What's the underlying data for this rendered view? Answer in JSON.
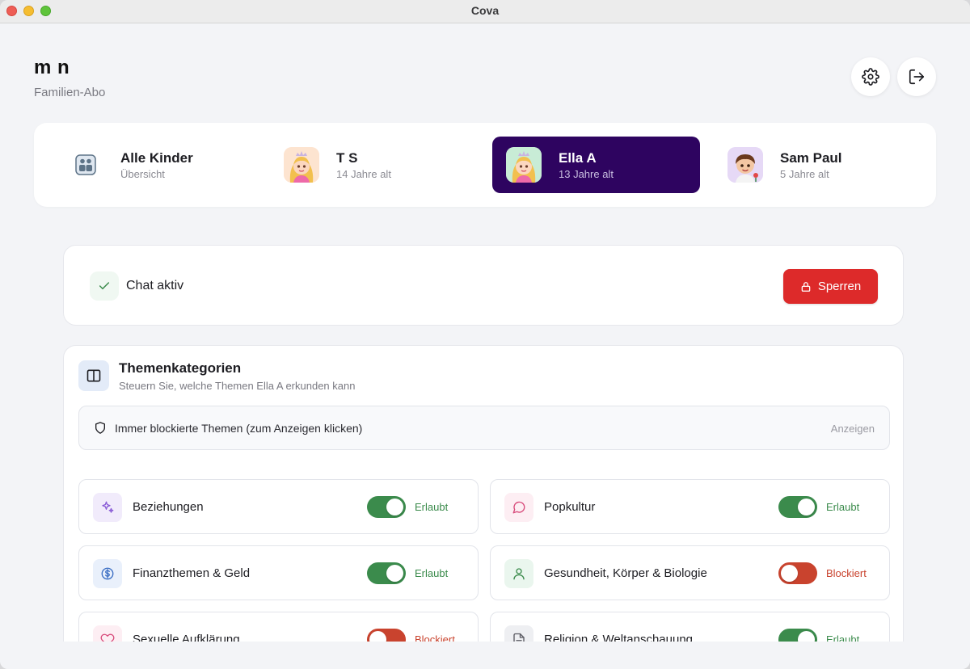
{
  "window": {
    "title": "Cova"
  },
  "header": {
    "user_name": "m n",
    "plan": "Familien-Abo"
  },
  "toolbar": {
    "settings_icon": "gear-icon",
    "logout_icon": "logout-icon"
  },
  "kids": [
    {
      "name": "Alle Kinder",
      "sub": "Übersicht",
      "active": false,
      "avatar": "family-icon"
    },
    {
      "name": "T S",
      "sub": "14 Jahre alt",
      "active": false,
      "avatar": "princess-avatar"
    },
    {
      "name": "Ella A",
      "sub": "13 Jahre alt",
      "active": true,
      "avatar": "princess-avatar"
    },
    {
      "name": "Sam Paul",
      "sub": "5 Jahre alt",
      "active": false,
      "avatar": "child-avatar"
    }
  ],
  "chat": {
    "status_label": "Chat aktiv",
    "lock_button": "Sperren"
  },
  "topics": {
    "title": "Themenkategorien",
    "subtitle": "Steuern Sie, welche Themen Ella A erkunden kann",
    "always_blocked": {
      "label": "Immer blockierte Themen (zum Anzeigen klicken)",
      "action": "Anzeigen"
    },
    "items": [
      {
        "label": "Beziehungen",
        "status": "Erlaubt",
        "allowed": true,
        "icon": "sparkles-icon",
        "icon_bg": "#f1ebfb",
        "icon_color": "#8a5cd6"
      },
      {
        "label": "Popkultur",
        "status": "Erlaubt",
        "allowed": true,
        "icon": "chat-bubble-icon",
        "icon_bg": "#fdeef3",
        "icon_color": "#d84b7b"
      },
      {
        "label": "Finanzthemen & Geld",
        "status": "Erlaubt",
        "allowed": true,
        "icon": "dollar-icon",
        "icon_bg": "#e9f0fb",
        "icon_color": "#3c6fc4"
      },
      {
        "label": "Gesundheit, Körper & Biologie",
        "status": "Blockiert",
        "allowed": false,
        "icon": "person-icon",
        "icon_bg": "#eaf6ee",
        "icon_color": "#3b8b4c"
      },
      {
        "label": "Sexuelle Aufklärung",
        "status": "Blockiert",
        "allowed": false,
        "icon": "heart-icon",
        "icon_bg": "#fdeef3",
        "icon_color": "#d84b7b"
      },
      {
        "label": "Religion & Weltanschauung",
        "status": "Erlaubt",
        "allowed": true,
        "icon": "document-icon",
        "icon_bg": "#eeeff2",
        "icon_color": "#5a5a62"
      }
    ]
  },
  "colors": {
    "active_kid_bg": "#2e0460",
    "lock_button_bg": "#dd2a2a",
    "toggle_on": "#3b8b4c",
    "toggle_off": "#c9432e"
  }
}
